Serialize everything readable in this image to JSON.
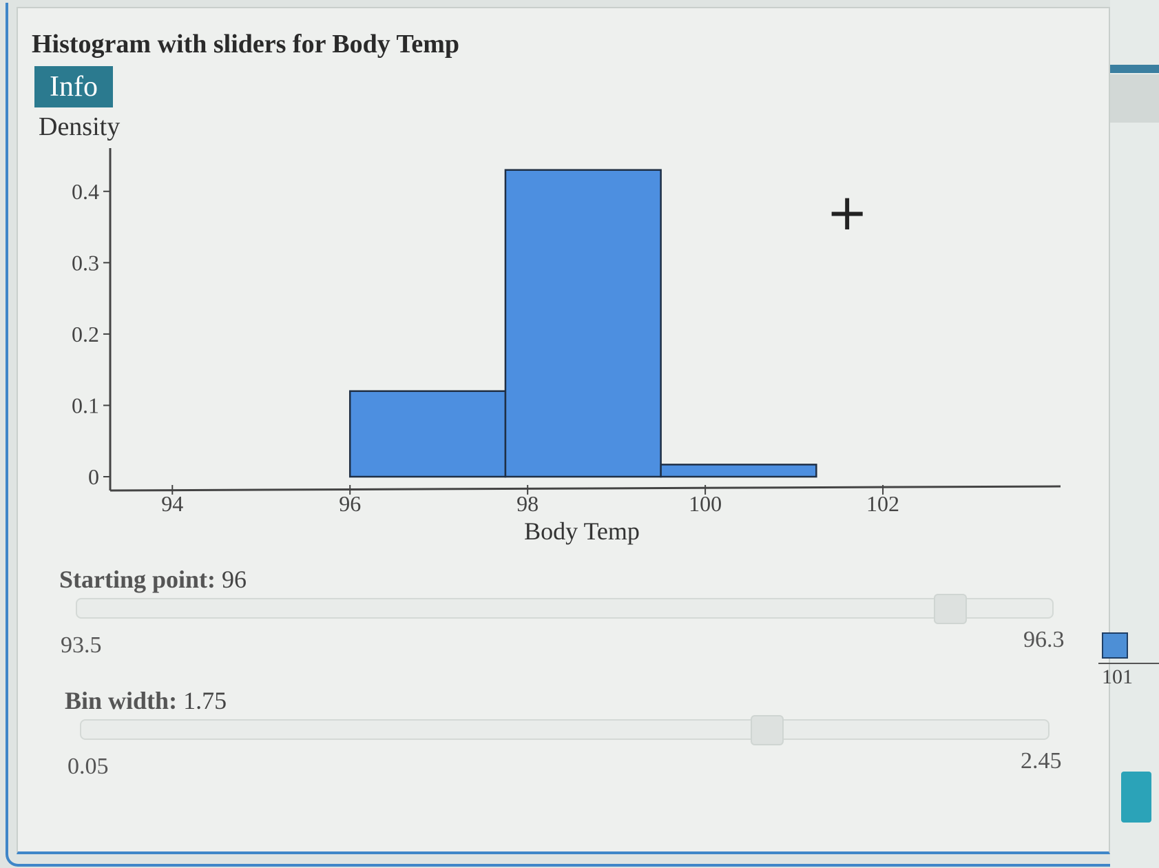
{
  "window": {
    "title": "Histogram with sliders for Body Temp"
  },
  "info_button": {
    "label": "Info"
  },
  "chart_data": {
    "type": "bar",
    "title": "",
    "xlabel": "Body Temp",
    "ylabel": "Density",
    "xlim": [
      93.3,
      104.0
    ],
    "ylim": [
      0,
      0.45
    ],
    "x_ticks": [
      "94",
      "96",
      "98",
      "100",
      "102"
    ],
    "y_ticks": [
      "0",
      "0.1",
      "0.2",
      "0.3",
      "0.4"
    ],
    "bins": [
      {
        "start": 96.0,
        "end": 97.75,
        "density": 0.12
      },
      {
        "start": 97.75,
        "end": 99.5,
        "density": 0.43
      },
      {
        "start": 99.5,
        "end": 101.25,
        "density": 0.017
      }
    ],
    "bar_color": "#4d8fe0",
    "grid": false
  },
  "sliders": {
    "starting_point": {
      "label": "Starting point:",
      "value": "96",
      "min": "93.5",
      "max": "96.3"
    },
    "bin_width": {
      "label": "Bin width:",
      "value": "1.75",
      "min": "0.05",
      "max": "2.45"
    }
  },
  "side_panel": {
    "tick_label": "101"
  }
}
